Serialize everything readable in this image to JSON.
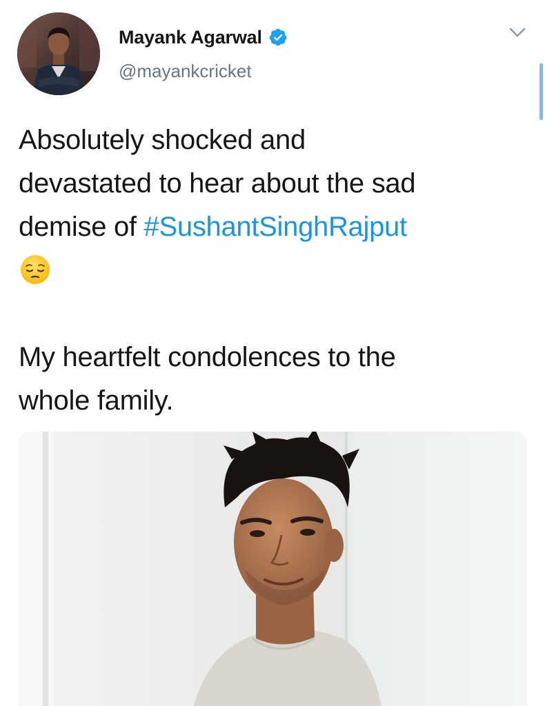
{
  "author": {
    "display_name": "Mayank Agarwal",
    "handle": "@mayankcricket",
    "verified": true,
    "avatar_icon": "profile-photo"
  },
  "tweet": {
    "line1": "Absolutely shocked and",
    "line2": "devastated to hear about the sad",
    "line3_prefix": "demise of ",
    "hashtag": "#SushantSinghRajput",
    "emoji": "pensive-face",
    "paragraph2_line1": "My heartfelt condolences to the",
    "paragraph2_line2": "whole family."
  },
  "colors": {
    "hashtag": "#1b95e0",
    "verified_badge": "#1da1f2",
    "handle": "#657786",
    "text": "#14171a"
  },
  "icons": {
    "menu": "chevron-down-icon",
    "verified": "verified-badge-icon"
  }
}
